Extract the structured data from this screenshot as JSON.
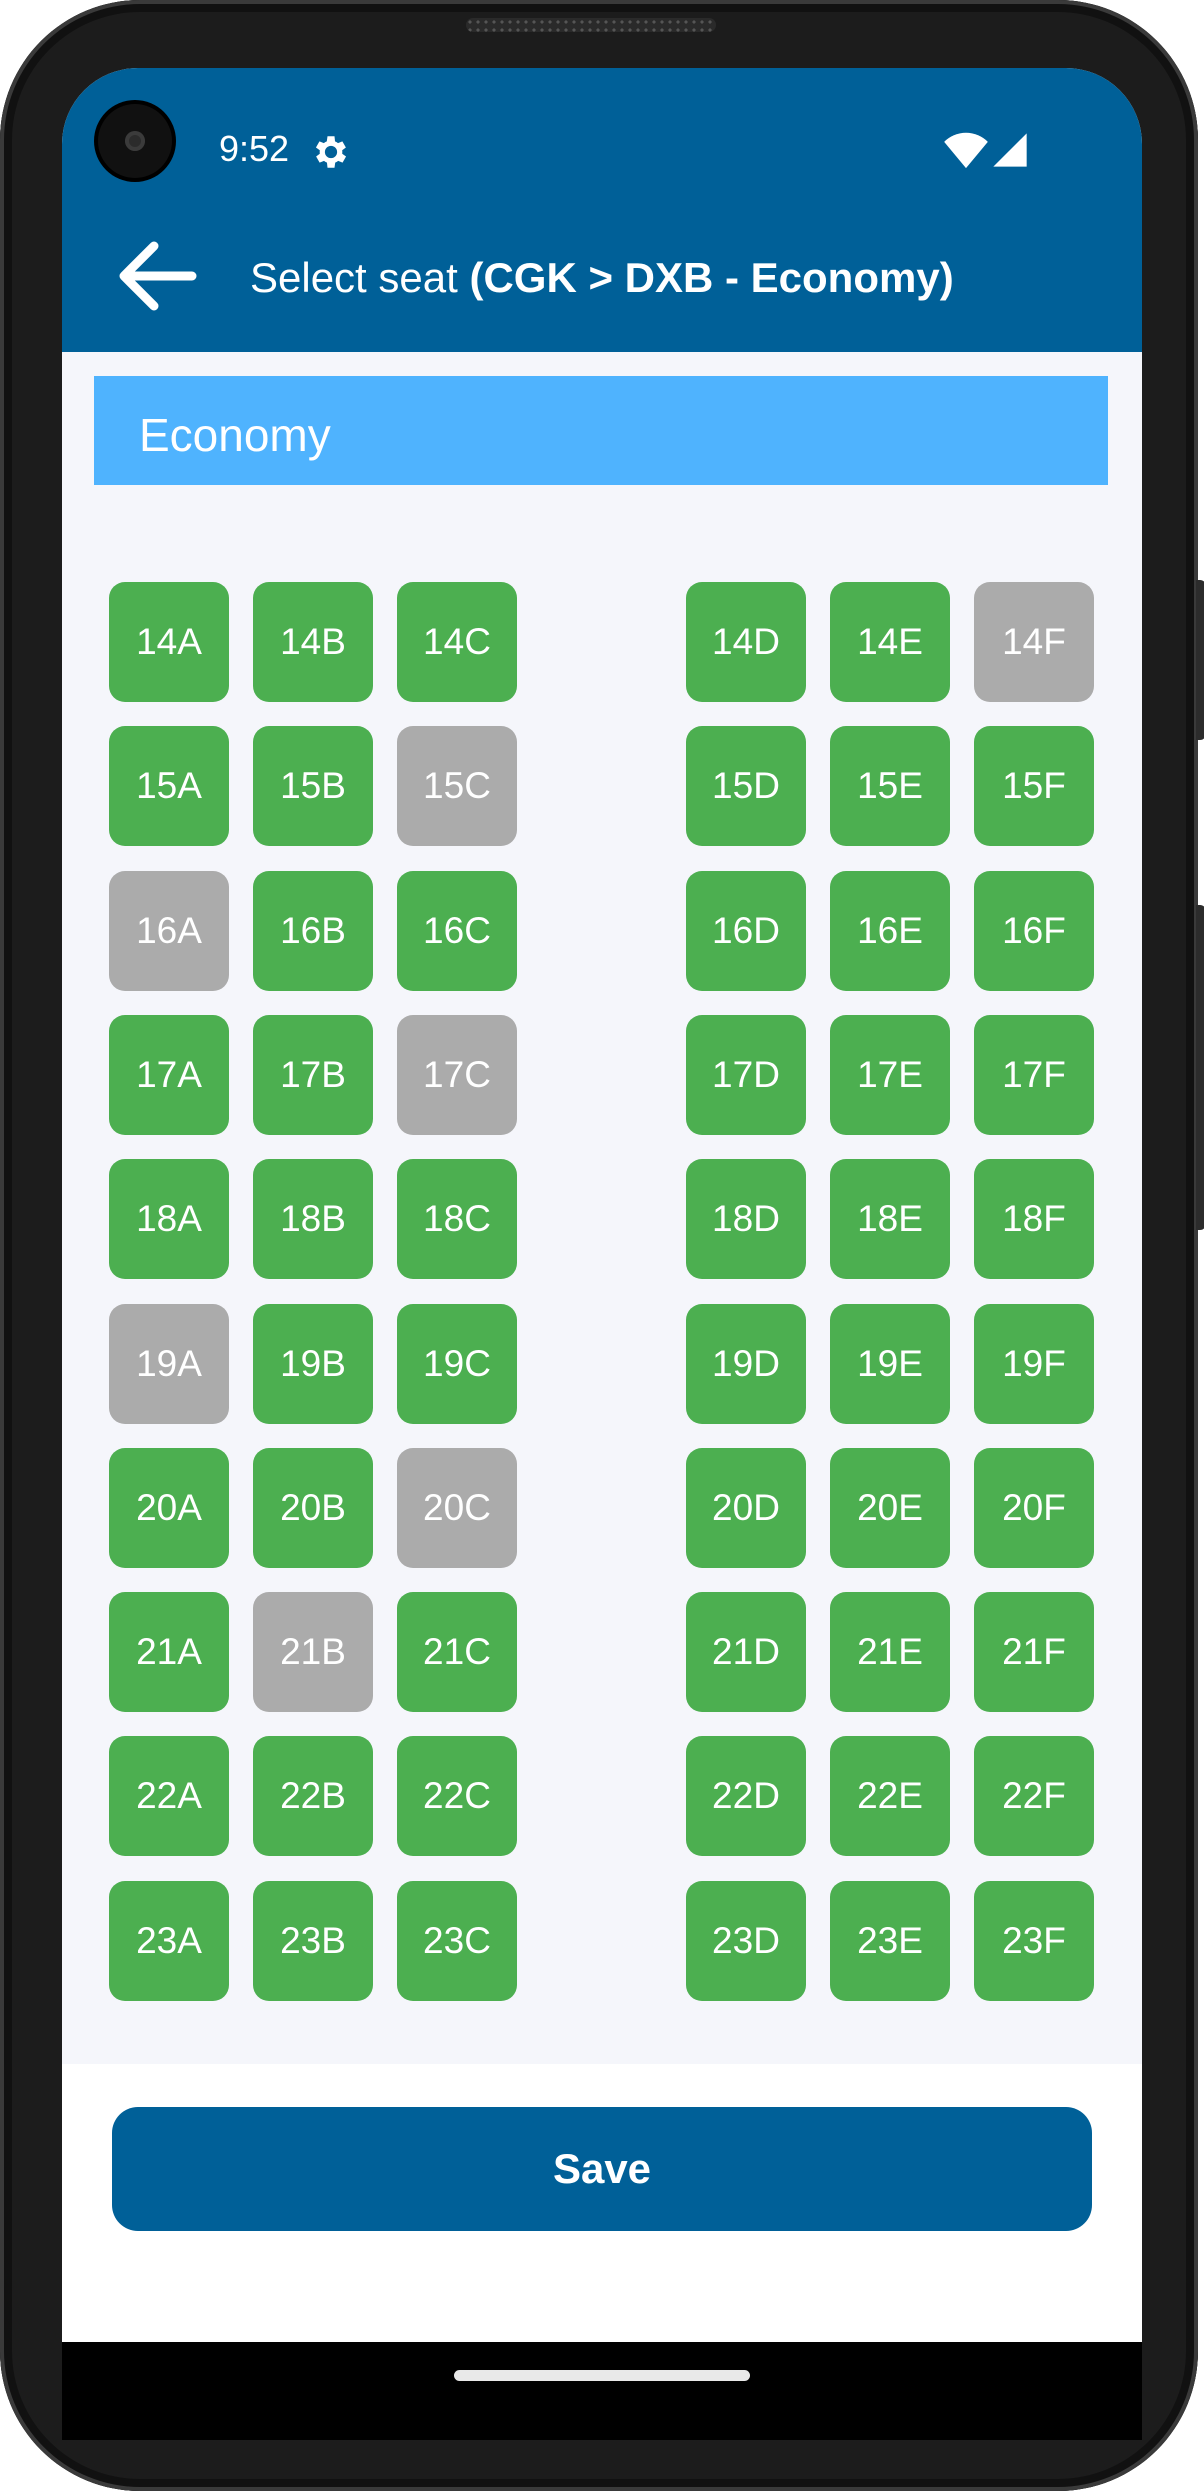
{
  "status_bar": {
    "time": "9:52"
  },
  "app_bar": {
    "title_prefix": "Select seat ",
    "title_bold": "(CGK > DXB - Economy)"
  },
  "section": {
    "title": "Economy"
  },
  "seat_columns": [
    "A",
    "B",
    "C",
    "D",
    "E",
    "F"
  ],
  "seat_rows": [
    {
      "row": "14",
      "seats": [
        {
          "label": "14A",
          "status": "available"
        },
        {
          "label": "14B",
          "status": "available"
        },
        {
          "label": "14C",
          "status": "available"
        },
        {
          "label": "14D",
          "status": "available"
        },
        {
          "label": "14E",
          "status": "available"
        },
        {
          "label": "14F",
          "status": "taken"
        }
      ]
    },
    {
      "row": "15",
      "seats": [
        {
          "label": "15A",
          "status": "available"
        },
        {
          "label": "15B",
          "status": "available"
        },
        {
          "label": "15C",
          "status": "taken"
        },
        {
          "label": "15D",
          "status": "available"
        },
        {
          "label": "15E",
          "status": "available"
        },
        {
          "label": "15F",
          "status": "available"
        }
      ]
    },
    {
      "row": "16",
      "seats": [
        {
          "label": "16A",
          "status": "taken"
        },
        {
          "label": "16B",
          "status": "available"
        },
        {
          "label": "16C",
          "status": "available"
        },
        {
          "label": "16D",
          "status": "available"
        },
        {
          "label": "16E",
          "status": "available"
        },
        {
          "label": "16F",
          "status": "available"
        }
      ]
    },
    {
      "row": "17",
      "seats": [
        {
          "label": "17A",
          "status": "available"
        },
        {
          "label": "17B",
          "status": "available"
        },
        {
          "label": "17C",
          "status": "taken"
        },
        {
          "label": "17D",
          "status": "available"
        },
        {
          "label": "17E",
          "status": "available"
        },
        {
          "label": "17F",
          "status": "available"
        }
      ]
    },
    {
      "row": "18",
      "seats": [
        {
          "label": "18A",
          "status": "available"
        },
        {
          "label": "18B",
          "status": "available"
        },
        {
          "label": "18C",
          "status": "available"
        },
        {
          "label": "18D",
          "status": "available"
        },
        {
          "label": "18E",
          "status": "available"
        },
        {
          "label": "18F",
          "status": "available"
        }
      ]
    },
    {
      "row": "19",
      "seats": [
        {
          "label": "19A",
          "status": "taken"
        },
        {
          "label": "19B",
          "status": "available"
        },
        {
          "label": "19C",
          "status": "available"
        },
        {
          "label": "19D",
          "status": "available"
        },
        {
          "label": "19E",
          "status": "available"
        },
        {
          "label": "19F",
          "status": "available"
        }
      ]
    },
    {
      "row": "20",
      "seats": [
        {
          "label": "20A",
          "status": "available"
        },
        {
          "label": "20B",
          "status": "available"
        },
        {
          "label": "20C",
          "status": "taken"
        },
        {
          "label": "20D",
          "status": "available"
        },
        {
          "label": "20E",
          "status": "available"
        },
        {
          "label": "20F",
          "status": "available"
        }
      ]
    },
    {
      "row": "21",
      "seats": [
        {
          "label": "21A",
          "status": "available"
        },
        {
          "label": "21B",
          "status": "taken"
        },
        {
          "label": "21C",
          "status": "available"
        },
        {
          "label": "21D",
          "status": "available"
        },
        {
          "label": "21E",
          "status": "available"
        },
        {
          "label": "21F",
          "status": "available"
        }
      ]
    },
    {
      "row": "22",
      "seats": [
        {
          "label": "22A",
          "status": "available"
        },
        {
          "label": "22B",
          "status": "available"
        },
        {
          "label": "22C",
          "status": "available"
        },
        {
          "label": "22D",
          "status": "available"
        },
        {
          "label": "22E",
          "status": "available"
        },
        {
          "label": "22F",
          "status": "available"
        }
      ]
    },
    {
      "row": "23",
      "seats": [
        {
          "label": "23A",
          "status": "available"
        },
        {
          "label": "23B",
          "status": "available"
        },
        {
          "label": "23C",
          "status": "available"
        },
        {
          "label": "23D",
          "status": "available"
        },
        {
          "label": "23E",
          "status": "available"
        },
        {
          "label": "23F",
          "status": "available"
        }
      ]
    }
  ],
  "save_label": "Save",
  "colors": {
    "primary": "#006098",
    "section_header": "#4fb3fe",
    "seat_available": "#4caf50",
    "seat_taken": "#ababab"
  },
  "icons": [
    "gear-icon",
    "wifi-icon",
    "signal-icon",
    "arrow-back-icon"
  ]
}
